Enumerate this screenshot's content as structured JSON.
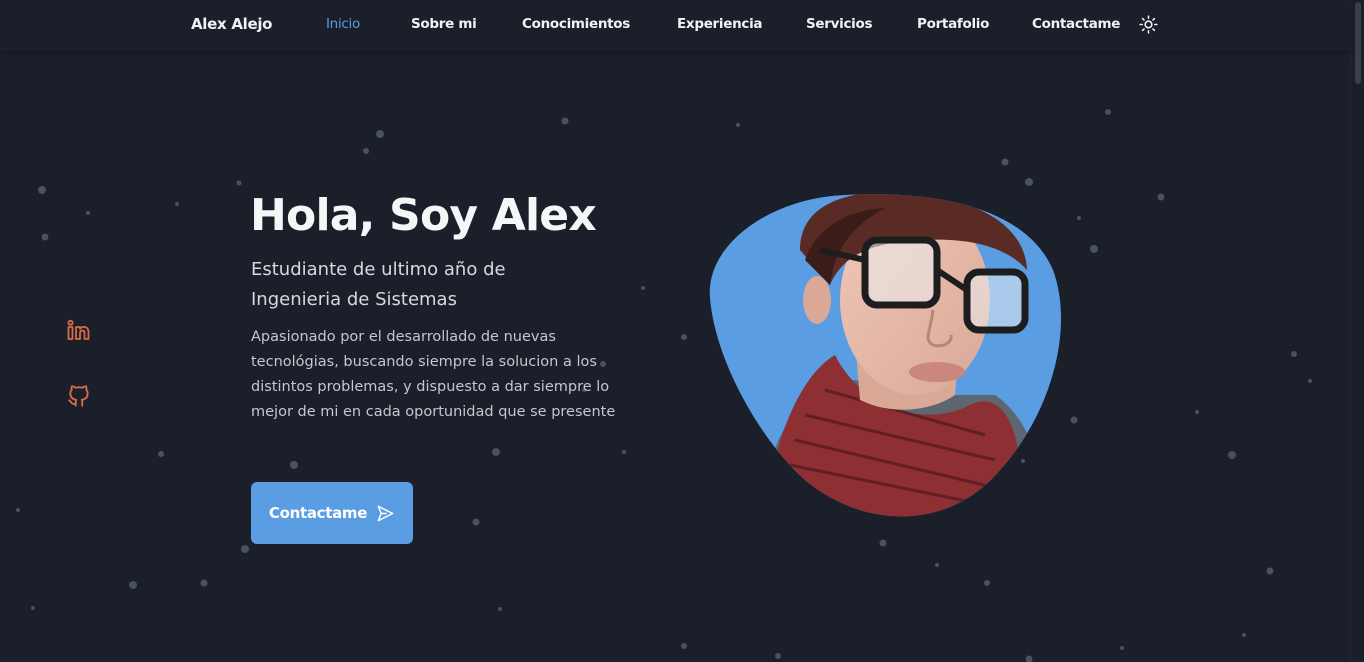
{
  "header": {
    "logo": "Alex Alejo",
    "nav": [
      {
        "label": "Inicio",
        "active": true
      },
      {
        "label": "Sobre mi"
      },
      {
        "label": "Conocimientos"
      },
      {
        "label": "Experiencia"
      },
      {
        "label": "Servicios"
      },
      {
        "label": "Portafolio"
      },
      {
        "label": "Contactame"
      }
    ],
    "theme_icon": "sun-icon"
  },
  "social": [
    {
      "icon": "linkedin-icon"
    },
    {
      "icon": "github-icon"
    }
  ],
  "hero": {
    "title": "Hola, Soy Alex",
    "subtitle": "Estudiante de ultimo año de Ingenieria de Sistemas",
    "description": "Apasionado por el desarrollado de nuevas tecnológias, buscando siempre la solucion a los distintos problemas, y dispuesto a dar siempre lo mejor de mi en cada oportunidad que se presente",
    "button_label": "Contactame",
    "button_icon": "send-icon",
    "photo": "profile-photo"
  },
  "colors": {
    "background": "#1a1f2a",
    "accent": "#5b9de2",
    "social_icon": "#d96a4a",
    "text": "#f1f2f4"
  }
}
